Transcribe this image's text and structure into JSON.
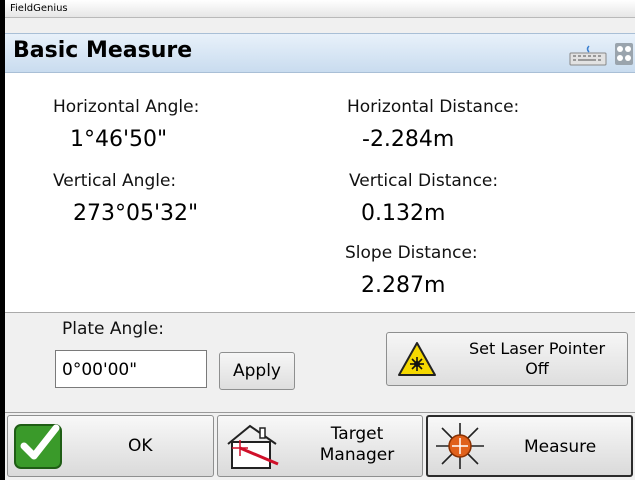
{
  "app": {
    "window_title": "FieldGenius"
  },
  "header": {
    "title": "Basic Measure",
    "keyboard_icon": "keyboard-icon",
    "settings_icon": "settings-icon"
  },
  "readings": {
    "horizontal_angle_label": "Horizontal Angle:",
    "horizontal_angle_value": "1°46'50\"",
    "vertical_angle_label": "Vertical Angle:",
    "vertical_angle_value": "273°05'32\"",
    "horizontal_distance_label": "Horizontal Distance:",
    "horizontal_distance_value": "-2.284m",
    "vertical_distance_label": "Vertical Distance:",
    "vertical_distance_value": "0.132m",
    "slope_distance_label": "Slope Distance:",
    "slope_distance_value": "2.287m"
  },
  "plate": {
    "label": "Plate Angle:",
    "value": "0°00'00\"",
    "apply_label": "Apply"
  },
  "laser": {
    "line1": "Set Laser Pointer",
    "line2": "Off",
    "icon": "laser-warning-icon"
  },
  "bottom": {
    "ok_label": "OK",
    "target_line1": "Target",
    "target_line2": "Manager",
    "measure_label": "Measure"
  },
  "colors": {
    "header_bg": "#c9dcef",
    "ok_green": "#3a9a2a",
    "measure_orange": "#e0601a",
    "laser_yellow": "#f5d800"
  }
}
